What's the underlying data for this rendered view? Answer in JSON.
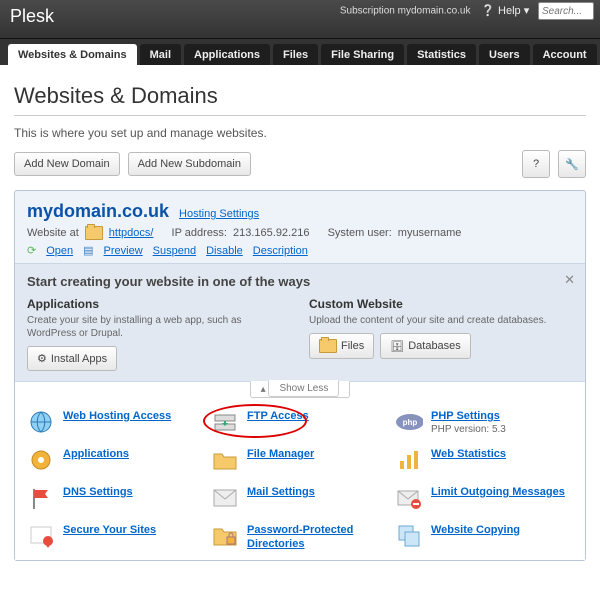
{
  "header": {
    "brand": "Plesk",
    "subscription_label": "Subscription",
    "subscription_value": "mydomain.co.uk",
    "help_label": "Help",
    "search_placeholder": "Search..."
  },
  "tabs": [
    {
      "label": "Websites & Domains",
      "active": true
    },
    {
      "label": "Mail"
    },
    {
      "label": "Applications"
    },
    {
      "label": "Files"
    },
    {
      "label": "File Sharing"
    },
    {
      "label": "Statistics"
    },
    {
      "label": "Users"
    },
    {
      "label": "Account"
    }
  ],
  "page": {
    "title": "Websites & Domains",
    "description": "This is where you set up and manage websites.",
    "add_domain": "Add New Domain",
    "add_subdomain": "Add New Subdomain"
  },
  "domain": {
    "name": "mydomain.co.uk",
    "hosting_settings": "Hosting Settings",
    "website_at_label": "Website at",
    "httpdocs": "httpdocs/",
    "ip_label": "IP address:",
    "ip_value": "213.165.92.216",
    "sysuser_label": "System user:",
    "sysuser_value": "myusername",
    "actions": {
      "open": "Open",
      "preview": "Preview",
      "suspend": "Suspend",
      "disable": "Disable",
      "description": "Description"
    }
  },
  "start": {
    "heading": "Start creating your website in one of the ways",
    "apps_title": "Applications",
    "apps_desc": "Create your site by installing a web app, such as WordPress or Drupal.",
    "install_apps": "Install Apps",
    "custom_title": "Custom Website",
    "custom_desc": "Upload the content of your site and create databases.",
    "files_btn": "Files",
    "db_btn": "Databases"
  },
  "showless": "Show Less",
  "tools": {
    "web_hosting_access": "Web Hosting Access",
    "ftp_access": "FTP Access",
    "php_settings": "PHP Settings",
    "php_version_note": "PHP version: 5.3",
    "applications": "Applications",
    "file_manager": "File Manager",
    "web_statistics": "Web Statistics",
    "dns_settings": "DNS Settings",
    "mail_settings": "Mail Settings",
    "limit_outgoing": "Limit Outgoing Messages",
    "secure_sites": "Secure Your Sites",
    "password_dirs": "Password-Protected Directories",
    "website_copying": "Website Copying"
  }
}
